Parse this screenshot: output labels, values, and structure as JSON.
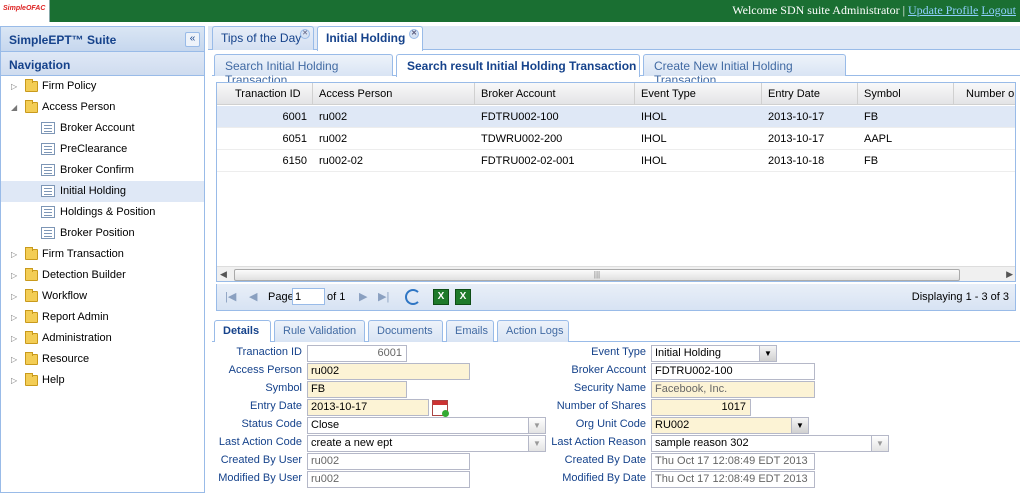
{
  "header": {
    "logo_text": "SimpleOFAC",
    "welcome_text": "Welcome SDN suite Administrator",
    "separator": "|",
    "update_profile": "Update Profile",
    "logout": "Logout"
  },
  "left_panel": {
    "title": "SimpleEPT™ Suite",
    "collapse_glyph": "«",
    "nav_title": "Navigation",
    "items": [
      {
        "label": "Firm Policy",
        "icon": "folder-icon",
        "level": 0,
        "expanded": false
      },
      {
        "label": "Access Person",
        "icon": "folder-icon",
        "level": 0,
        "expanded": true
      },
      {
        "label": "Broker Account",
        "icon": "document-icon",
        "level": 1
      },
      {
        "label": "PreClearance",
        "icon": "document-icon",
        "level": 1
      },
      {
        "label": "Broker Confirm",
        "icon": "document-icon",
        "level": 1
      },
      {
        "label": "Initial Holding",
        "icon": "document-icon",
        "level": 1,
        "selected": true
      },
      {
        "label": "Holdings & Position",
        "icon": "document-icon",
        "level": 1
      },
      {
        "label": "Broker Position",
        "icon": "document-icon",
        "level": 1
      },
      {
        "label": "Firm Transaction",
        "icon": "folder-icon",
        "level": 0,
        "expanded": false
      },
      {
        "label": "Detection Builder",
        "icon": "folder-icon",
        "level": 0,
        "expanded": false
      },
      {
        "label": "Workflow",
        "icon": "folder-icon",
        "level": 0,
        "expanded": false
      },
      {
        "label": "Report Admin",
        "icon": "folder-icon",
        "level": 0,
        "expanded": false
      },
      {
        "label": "Administration",
        "icon": "folder-icon",
        "level": 0,
        "expanded": false
      },
      {
        "label": "Resource",
        "icon": "folder-icon",
        "level": 0,
        "expanded": false
      },
      {
        "label": "Help",
        "icon": "folder-icon",
        "level": 0,
        "expanded": false
      }
    ]
  },
  "main_tabs": [
    {
      "label": "Tips of the Day",
      "active": false
    },
    {
      "label": "Initial Holding",
      "active": true
    }
  ],
  "sub_tabs": [
    {
      "label": "Search Initial Holding Transaction",
      "active": false
    },
    {
      "label": "Search result Initial Holding Transaction",
      "active": true
    },
    {
      "label": "Create New Initial Holding Transaction",
      "active": false
    }
  ],
  "grid": {
    "columns": [
      "Tranaction ID",
      "Access Person",
      "Broker Account",
      "Event Type",
      "Entry Date",
      "Symbol",
      "Number o"
    ],
    "rows": [
      {
        "id": "6001",
        "access_person": "ru002",
        "broker_account": "FDTRU002-100",
        "event_type": "IHOL",
        "entry_date": "2013-10-17",
        "symbol": "FB",
        "selected": true
      },
      {
        "id": "6051",
        "access_person": "ru002",
        "broker_account": "TDWRU002-200",
        "event_type": "IHOL",
        "entry_date": "2013-10-17",
        "symbol": "AAPL",
        "selected": false
      },
      {
        "id": "6150",
        "access_person": "ru002-02",
        "broker_account": "FDTRU002-02-001",
        "event_type": "IHOL",
        "entry_date": "2013-10-18",
        "symbol": "FB",
        "selected": false
      }
    ]
  },
  "pager": {
    "page_label": "Page",
    "page_value": "1",
    "of_label": "of 1",
    "displaying": "Displaying 1 - 3 of 3"
  },
  "detail_tabs": [
    {
      "label": "Details",
      "active": true
    },
    {
      "label": "Rule Validation",
      "active": false
    },
    {
      "label": "Documents",
      "active": false
    },
    {
      "label": "Emails",
      "active": false
    },
    {
      "label": "Action Logs",
      "active": false
    }
  ],
  "form": {
    "transaction_id_label": "Tranaction ID",
    "transaction_id": "6001",
    "access_person_label": "Access Person",
    "access_person": "ru002",
    "symbol_label": "Symbol",
    "symbol": "FB",
    "entry_date_label": "Entry Date",
    "entry_date": "2013-10-17",
    "status_code_label": "Status Code",
    "status_code": "Close",
    "last_action_code_label": "Last Action Code",
    "last_action_code": "create a new ept",
    "created_by_user_label": "Created By User",
    "created_by_user": "ru002",
    "modified_by_user_label": "Modified By User",
    "modified_by_user": "ru002",
    "event_type_label": "Event Type",
    "event_type": "Initial Holding",
    "broker_account_label": "Broker Account",
    "broker_account": "FDTRU002-100",
    "security_name_label": "Security Name",
    "security_name": "Facebook, Inc.",
    "number_of_shares_label": "Number of Shares",
    "number_of_shares": "1017",
    "org_unit_code_label": "Org Unit Code",
    "org_unit_code": "RU002",
    "last_action_reason_label": "Last Action Reason",
    "last_action_reason": "sample reason 302",
    "created_by_date_label": "Created By Date",
    "created_by_date": "Thu Oct 17 12:08:49 EDT 2013",
    "modified_by_date_label": "Modified By Date",
    "modified_by_date": "Thu Oct 17 12:08:49 EDT 2013"
  },
  "colors": {
    "topbar": "#1a6f32",
    "panel_border": "#99bbe8",
    "selected_row": "#dfe8f6",
    "required_field": "#fcf3d5"
  }
}
